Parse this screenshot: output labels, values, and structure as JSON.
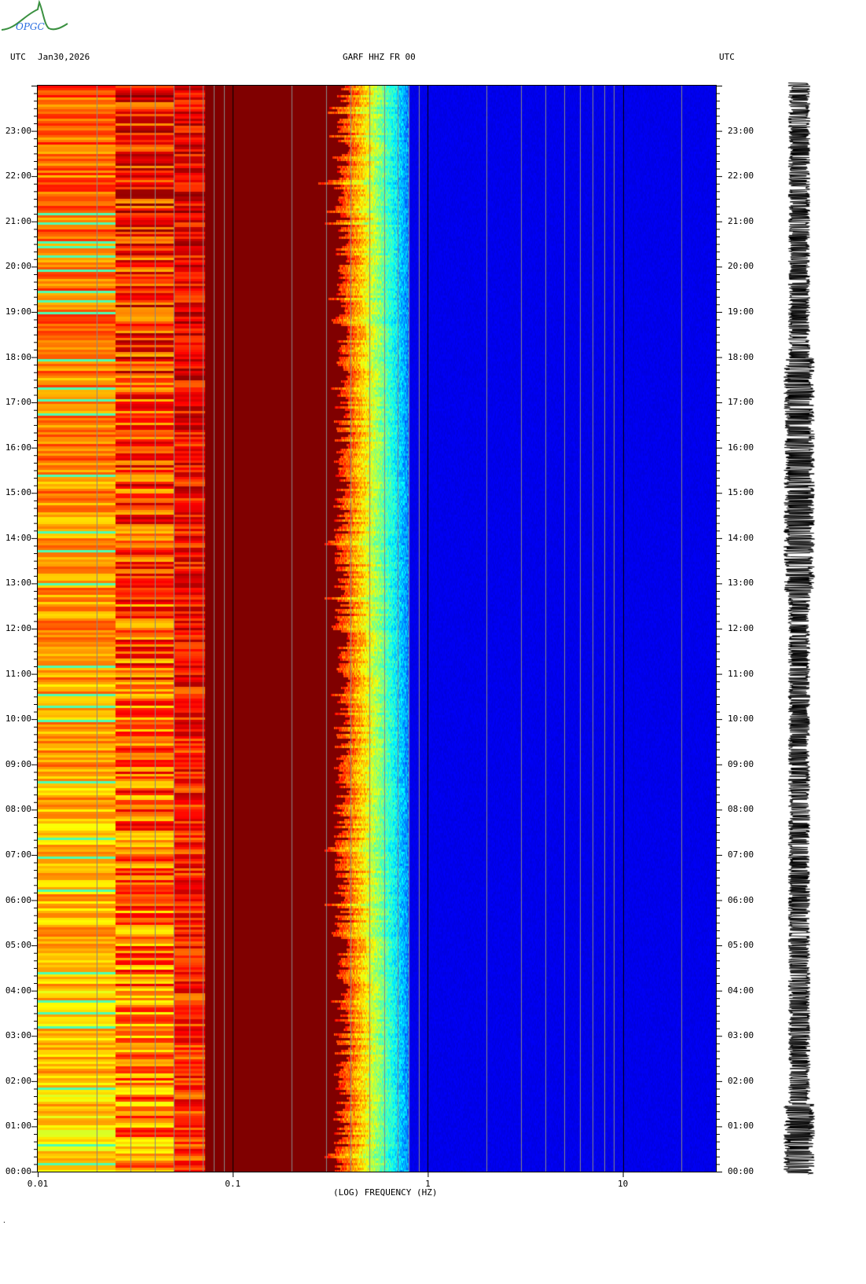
{
  "header": {
    "logo_text": "OPGC",
    "tz_left": "UTC",
    "date": "Jan30,2026",
    "station": "GARF HHZ FR 00",
    "tz_right": "UTC"
  },
  "footer_mark": "·",
  "chart_data": {
    "type": "heatmap",
    "title": "GARF HHZ FR 00",
    "date": "Jan30,2026",
    "xlabel": "(LOG) FREQUENCY (HZ)",
    "ylabel": "UTC",
    "xscale": "log",
    "xlim": [
      0.01,
      30
    ],
    "ylim_hours": [
      0,
      24
    ],
    "x_ticks": [
      {
        "value": 0.01,
        "label": "0.01"
      },
      {
        "value": 0.1,
        "label": "0.1"
      },
      {
        "value": 1,
        "label": "1"
      },
      {
        "value": 10,
        "label": "10"
      }
    ],
    "y_ticks": [
      {
        "hour": 0,
        "label": "00:00"
      },
      {
        "hour": 1,
        "label": "01:00"
      },
      {
        "hour": 2,
        "label": "02:00"
      },
      {
        "hour": 3,
        "label": "03:00"
      },
      {
        "hour": 4,
        "label": "04:00"
      },
      {
        "hour": 5,
        "label": "05:00"
      },
      {
        "hour": 6,
        "label": "06:00"
      },
      {
        "hour": 7,
        "label": "07:00"
      },
      {
        "hour": 8,
        "label": "08:00"
      },
      {
        "hour": 9,
        "label": "09:00"
      },
      {
        "hour": 10,
        "label": "10:00"
      },
      {
        "hour": 11,
        "label": "11:00"
      },
      {
        "hour": 12,
        "label": "12:00"
      },
      {
        "hour": 13,
        "label": "13:00"
      },
      {
        "hour": 14,
        "label": "14:00"
      },
      {
        "hour": 15,
        "label": "15:00"
      },
      {
        "hour": 16,
        "label": "16:00"
      },
      {
        "hour": 17,
        "label": "17:00"
      },
      {
        "hour": 18,
        "label": "18:00"
      },
      {
        "hour": 19,
        "label": "19:00"
      },
      {
        "hour": 20,
        "label": "20:00"
      },
      {
        "hour": 21,
        "label": "21:00"
      },
      {
        "hour": 22,
        "label": "22:00"
      },
      {
        "hour": 23,
        "label": "23:00"
      }
    ],
    "frequency_bands_hz": {
      "microseism_edge": [
        0.3,
        0.4
      ],
      "transition_end": 0.8
    },
    "colormap": "jet",
    "grid": true
  }
}
